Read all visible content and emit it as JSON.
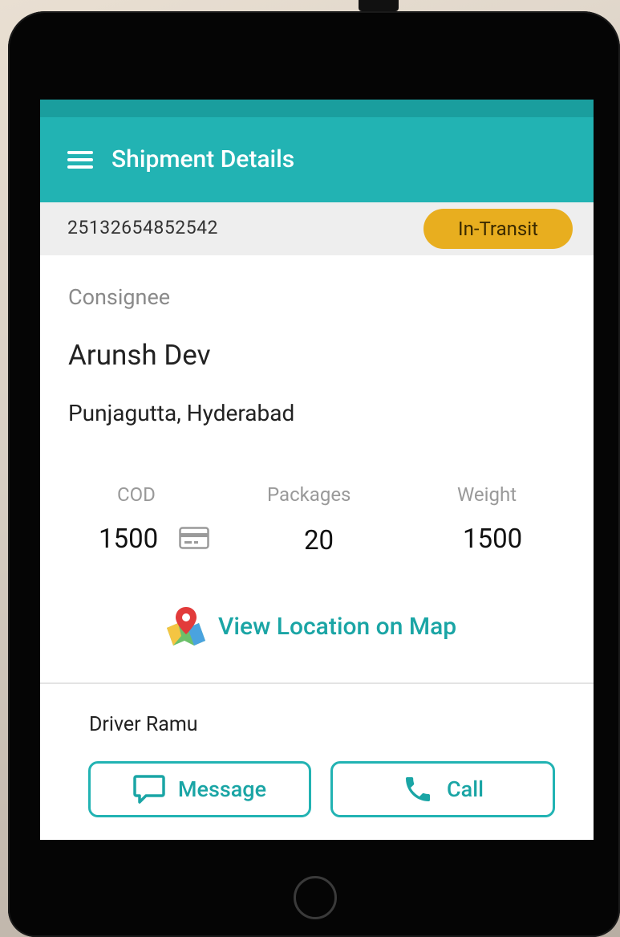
{
  "appbar": {
    "title": "Shipment Details",
    "menu_icon": "hamburger-menu-icon"
  },
  "shipment": {
    "id": "25132654852542",
    "status": "In-Transit",
    "status_color": "#e8ae1f"
  },
  "consignee": {
    "label": "Consignee",
    "name": "Arunsh Dev",
    "address": "Punjagutta, Hyderabad"
  },
  "stats": [
    {
      "label": "COD",
      "value": "1500",
      "icon": "card-icon"
    },
    {
      "label": "Packages",
      "value": "20"
    },
    {
      "label": "Weight",
      "value": "1500"
    }
  ],
  "map": {
    "label": "View Location on Map",
    "icon": "map-pin-icon"
  },
  "driver": {
    "label": "Driver Ramu"
  },
  "actions": {
    "message": "Message",
    "call": "Call"
  },
  "colors": {
    "accent": "#22b3b3",
    "accent_dark": "#1a9e9e",
    "badge": "#e8ae1f"
  }
}
